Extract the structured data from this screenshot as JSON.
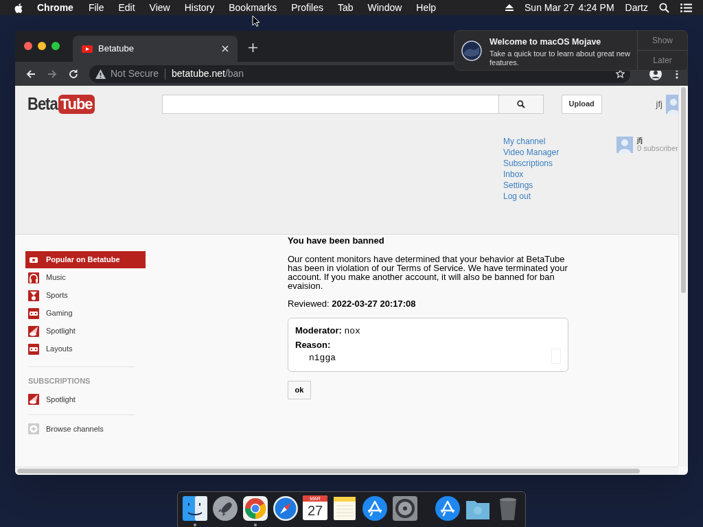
{
  "menu_bar": {
    "app": "Chrome",
    "menus": [
      "File",
      "Edit",
      "View",
      "History",
      "Bookmarks",
      "Profiles",
      "Tab",
      "Window",
      "Help"
    ],
    "date": "Sun Mar 27",
    "time": "4:24 PM",
    "user": "Dartz"
  },
  "browser": {
    "tab": {
      "title": "Betatube",
      "selected": true
    },
    "nav": [
      {
        "kind": "back",
        "disabled": false
      },
      {
        "kind": "forward",
        "disabled": true
      },
      {
        "kind": "reload",
        "disabled": false
      }
    ],
    "address": {
      "security": "Not Secure",
      "host": "betatube.net",
      "path": "/ban"
    }
  },
  "notification": {
    "title": "Welcome to macOS Mojave",
    "body": "Take a quick tour to learn about great new features.",
    "buttons": [
      "Show",
      "Later"
    ]
  },
  "site": {
    "logo": [
      "Beta",
      "Tube"
    ],
    "upload": "Upload",
    "user": "jfj",
    "account_menu": [
      "My channel",
      "Video Manager",
      "Subscriptions",
      "Inbox",
      "Settings",
      "Log out"
    ],
    "channel": {
      "name": "jfj",
      "subscribers": "0 subscriber"
    },
    "sidebar": [
      {
        "label": "Popular on Betatube",
        "kind": "star",
        "selected": true
      },
      {
        "label": "Music",
        "kind": "headphones",
        "selected": false
      },
      {
        "label": "Sports",
        "kind": "medal",
        "selected": false
      },
      {
        "label": "Gaming",
        "kind": "gamepad",
        "selected": false
      },
      {
        "label": "Spotlight",
        "kind": "spotlight",
        "selected": false
      },
      {
        "label": "Layouts",
        "kind": "gamepad",
        "selected": false
      }
    ],
    "subscriptions_heading": "SUBSCRIPTIONS",
    "subscriptions": [
      {
        "label": "Spotlight",
        "kind": "spotlight",
        "selected": false
      }
    ],
    "browse": "Browse channels",
    "ban": {
      "heading": "You have been banned",
      "message": "Our content monitors have determined that your behavior at BetaTube has been in violation of our Terms of Service. We have terminated your account. If you make another account, it will also be banned for ban evaision.",
      "reviewed_label": "Reviewed:",
      "reviewed_at": "2022-03-27 20:17:08",
      "moderator_label": "Moderator:",
      "moderator": "nox",
      "reason_label": "Reason:",
      "reason": "nigga",
      "ok": "ok"
    }
  },
  "dock": [
    {
      "kind": "finder",
      "running": true
    },
    {
      "kind": "launchpad",
      "running": false
    },
    {
      "kind": "chrome",
      "running": true
    },
    {
      "kind": "safari",
      "running": false
    },
    {
      "kind": "calendar",
      "running": false,
      "month": "MAR",
      "day": "27"
    },
    {
      "kind": "notes",
      "running": false
    },
    {
      "kind": "appstore",
      "running": false
    },
    {
      "kind": "settings",
      "running": false
    },
    {
      "kind": "separator"
    },
    {
      "kind": "appstore",
      "running": false
    },
    {
      "kind": "folder",
      "running": false
    },
    {
      "kind": "trash",
      "running": false
    }
  ]
}
